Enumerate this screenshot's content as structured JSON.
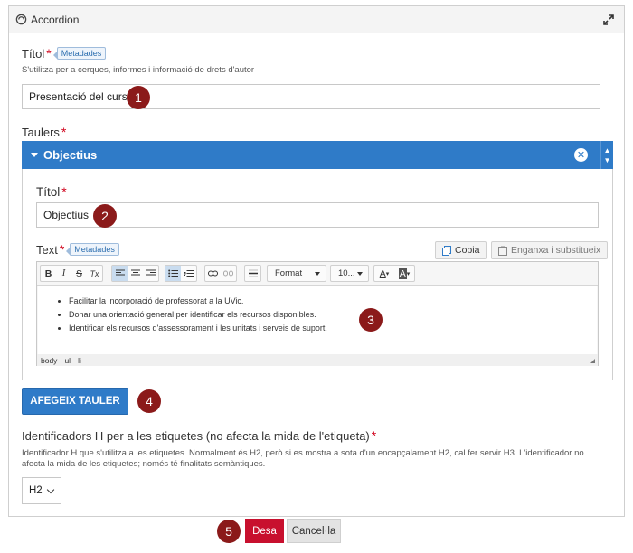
{
  "panel": {
    "title": "Accordion",
    "icon": "accordion-icon",
    "expand_icon": "expand-icon"
  },
  "title_field": {
    "label": "Títol",
    "required_mark": "*",
    "meta_tag": "Metadades",
    "help": "S'utilitza per a cerques, informes i informació de drets d'autor",
    "value": "Presentació del curs",
    "badge": "1"
  },
  "panels_field": {
    "label": "Taulers",
    "required_mark": "*"
  },
  "accordion_item": {
    "title": "Objectius",
    "close_icon": "✕",
    "title_label": "Títol",
    "title_required": "*",
    "title_value": "Objectius",
    "title_badge": "2",
    "text_label": "Text",
    "text_required": "*",
    "text_meta_tag": "Metadades",
    "copy_button": "Copia",
    "paste_button": "Enganxa i substitueix"
  },
  "editor": {
    "toolbar": {
      "bold": "B",
      "italic": "I",
      "strike": "S",
      "clear": "Tx",
      "format_select": "Format",
      "size_select": "10...",
      "text_color": "A",
      "bg_color": "A"
    },
    "list_items": [
      "Facilitar la incorporació de professorat a la UVic.",
      "Donar una orientació general per identificar els recursos disponibles.",
      "Identificar els recursos d'assessorament i les unitats i serveis de suport."
    ],
    "badge": "3",
    "status_path": [
      "body",
      "ul",
      "li"
    ]
  },
  "add_panel": {
    "label": "AFEGEIX TAULER",
    "badge": "4"
  },
  "heading_field": {
    "label": "Identificadors H per a les etiquetes (no afecta la mida de l'etiqueta)",
    "required_mark": "*",
    "help_line1": "Identificador H que s'utilitza a les etiquetes. Normalment és H2, però si es mostra a sota d'un encapçalament H2, cal fer servir H3. L'identificador no",
    "help_line2": "afecta la mida de les etiquetes; només té finalitats semàntiques.",
    "value": "H2"
  },
  "actions": {
    "save": "Desa",
    "cancel": "Cancel·la",
    "badge": "5"
  },
  "colors": {
    "accent": "#2f7bc8",
    "danger": "#c8102e",
    "badge": "#8b1a1a"
  }
}
